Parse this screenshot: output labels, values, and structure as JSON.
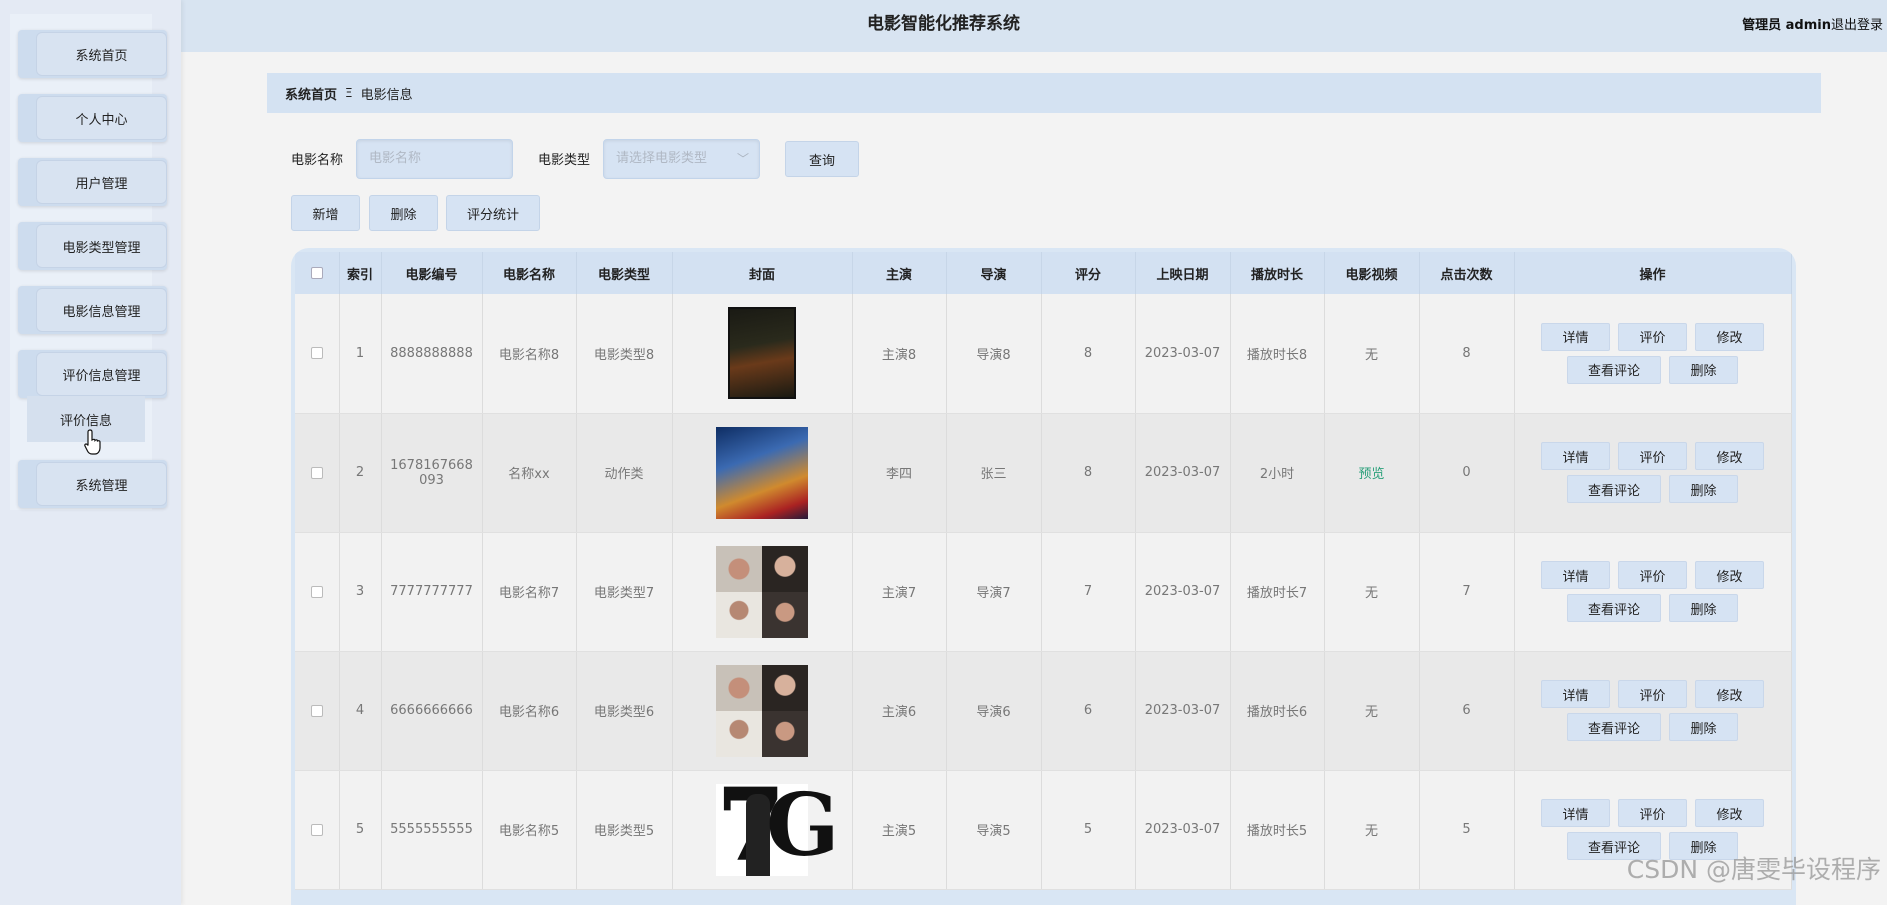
{
  "header": {
    "title": "电影智能化推荐系统",
    "user": "管理员 admin",
    "logout": "退出登录"
  },
  "sidebar": {
    "items": [
      {
        "label": "系统首页"
      },
      {
        "label": "个人中心"
      },
      {
        "label": "用户管理"
      },
      {
        "label": "电影类型管理"
      },
      {
        "label": "电影信息管理"
      },
      {
        "label": "评价信息管理"
      },
      {
        "label": "系统管理"
      }
    ],
    "submenu": "评价信息"
  },
  "breadcrumb": {
    "home": "系统首页",
    "separator": "Ξ",
    "current": "电影信息"
  },
  "search": {
    "name_label": "电影名称",
    "name_placeholder": "电影名称",
    "type_label": "电影类型",
    "type_placeholder": "请选择电影类型",
    "query": "查询"
  },
  "actions": {
    "add": "新增",
    "delete": "删除",
    "stats": "评分统计"
  },
  "table": {
    "headers": [
      "",
      "索引",
      "电影编号",
      "电影名称",
      "电影类型",
      "封面",
      "主演",
      "导演",
      "评分",
      "上映日期",
      "播放时长",
      "电影视频",
      "点击次数",
      "操作"
    ],
    "ops": {
      "detail": "详情",
      "rate": "评价",
      "edit": "修改",
      "comments": "查看评论",
      "delete": "删除"
    },
    "rows": [
      {
        "index": "1",
        "code": "8888888888",
        "name": "电影名称8",
        "type": "电影类型8",
        "actor": "主演8",
        "director": "导演8",
        "score": "8",
        "date": "2023-03-07",
        "duration": "播放时长8",
        "video": "无",
        "clicks": "8"
      },
      {
        "index": "2",
        "code": "1678167668093",
        "name": "名称xx",
        "type": "动作类",
        "actor": "李四",
        "director": "张三",
        "score": "8",
        "date": "2023-03-07",
        "duration": "2小时",
        "video": "预览",
        "clicks": "0"
      },
      {
        "index": "3",
        "code": "7777777777",
        "name": "电影名称7",
        "type": "电影类型7",
        "actor": "主演7",
        "director": "导演7",
        "score": "7",
        "date": "2023-03-07",
        "duration": "播放时长7",
        "video": "无",
        "clicks": "7"
      },
      {
        "index": "4",
        "code": "6666666666",
        "name": "电影名称6",
        "type": "电影类型6",
        "actor": "主演6",
        "director": "导演6",
        "score": "6",
        "date": "2023-03-07",
        "duration": "播放时长6",
        "video": "无",
        "clicks": "6"
      },
      {
        "index": "5",
        "code": "5555555555",
        "name": "电影名称5",
        "type": "电影类型5",
        "actor": "主演5",
        "director": "导演5",
        "score": "5",
        "date": "2023-03-07",
        "duration": "播放时长5",
        "video": "无",
        "clicks": "5"
      }
    ]
  },
  "watermark": "CSDN @唐雯毕设程序",
  "colors": {
    "accent": "#d6e3f3",
    "preview": "#2aa07a"
  }
}
